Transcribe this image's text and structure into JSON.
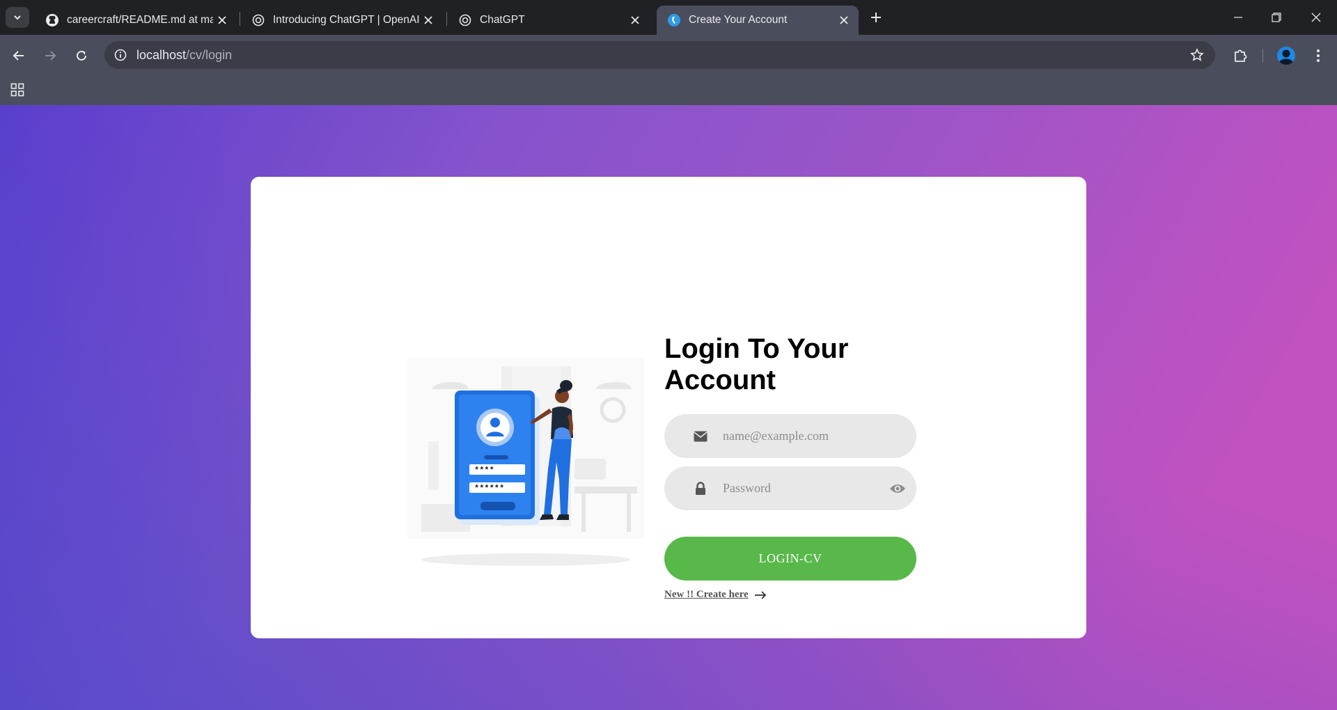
{
  "browser": {
    "tabs": [
      {
        "title": "careercraft/README.md at main",
        "icon": "github-icon"
      },
      {
        "title": "Introducing ChatGPT | OpenAI",
        "icon": "openai-icon"
      },
      {
        "title": "ChatGPT",
        "icon": "openai-icon"
      },
      {
        "title": "Create Your Account",
        "icon": "site-icon",
        "active": true
      }
    ],
    "url_host": "localhost",
    "url_path": "/cv/login"
  },
  "login": {
    "heading": "Login To Your Account",
    "email_placeholder": "name@example.com",
    "password_placeholder": "Password",
    "submit_label": "LOGIN-CV",
    "create_link": "New !! Create here",
    "accent_color": "#58b849"
  }
}
